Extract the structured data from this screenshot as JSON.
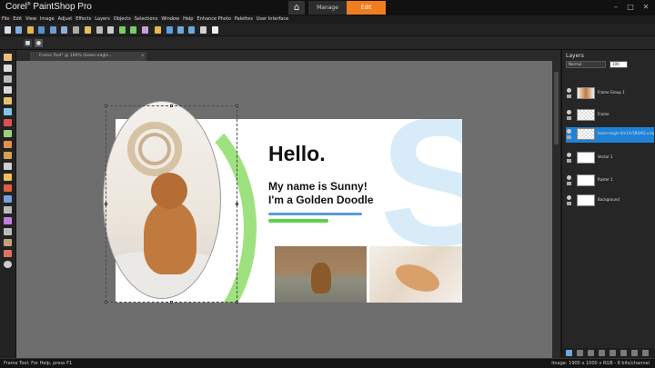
{
  "app": {
    "brand_corel": "Corel",
    "brand_name": "PaintShop Pro",
    "reg_mark": "®"
  },
  "workspace_tabs": {
    "home_icon": "⌂",
    "manage": "Manage",
    "edit": "Edit",
    "active": "Edit"
  },
  "window_controls": {
    "minimize": "–",
    "maximize": "□",
    "close": "✕"
  },
  "menu": [
    "File",
    "Edit",
    "View",
    "Image",
    "Adjust",
    "Effects",
    "Layers",
    "Objects",
    "Selections",
    "Window",
    "Help",
    "Enhance Photo",
    "Palettes",
    "User Interface"
  ],
  "document": {
    "tab_label": "Frame Tool* @ 100% (boxer-eagle...",
    "tab_close": "x"
  },
  "design": {
    "hello": "Hello.",
    "line1": "My name is Sunny!",
    "line2": "I'm a Golden Doodle",
    "big_letter": "S"
  },
  "layers_panel": {
    "title": "Layers",
    "blend_mode": "Normal",
    "opacity": "100",
    "layers": [
      {
        "name": "Frame Group 1",
        "thumb": "img",
        "selected": false
      },
      {
        "name": "Frame",
        "thumb": "checker",
        "selected": false
      },
      {
        "name": "boxer-eagle-4m1Ar5BDAQ-unsplash",
        "thumb": "checker",
        "selected": true
      },
      {
        "name": "Vector 1",
        "thumb": "white",
        "selected": false
      },
      {
        "name": "Raster 1",
        "thumb": "white",
        "selected": false
      },
      {
        "name": "Background",
        "thumb": "white",
        "selected": false
      }
    ]
  },
  "status": {
    "left": "Frame Tool: For Help, press F1",
    "right": "Image: 1900 x 1000 x RGB - 8 bits/channel"
  },
  "colors": {
    "accent": "#f07d1e",
    "selection": "#1e82d6",
    "green": "#9ee27f",
    "blue_bar": "#5b9bd8"
  }
}
